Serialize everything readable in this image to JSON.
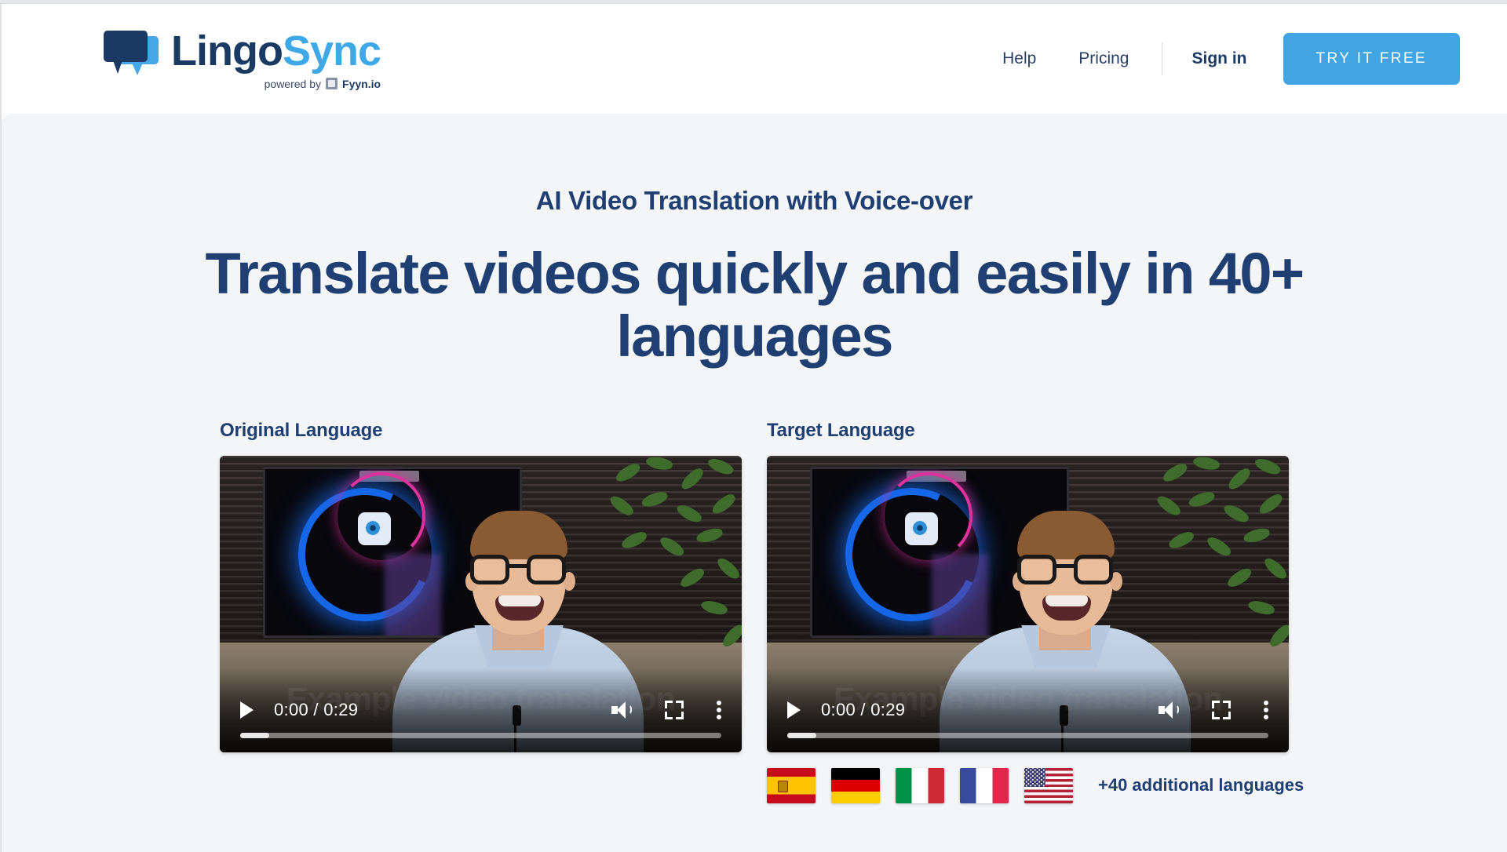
{
  "brand": {
    "name_part1": "Lingo",
    "name_part2": "Sync",
    "powered_label": "powered by",
    "powered_name": "Fyyn.io",
    "logo_icon": "speech-bubbles-icon",
    "fyyn_icon": "fyyn-square-icon",
    "colors": {
      "navy": "#1b3a63",
      "light_blue": "#3fa9e8"
    }
  },
  "header": {
    "nav": [
      {
        "label": "Help"
      },
      {
        "label": "Pricing"
      }
    ],
    "signin_label": "Sign in",
    "cta_label": "TRY IT FREE",
    "cta_color": "#41a5e4"
  },
  "hero": {
    "eyebrow": "AI Video Translation with Voice-over",
    "headline": "Translate videos quickly and easily in 40+ languages",
    "heading_color": "#1f3f73",
    "background_color": "#f4f5f6"
  },
  "videos": [
    {
      "label": "Original Language",
      "player": {
        "play_icon": "play-icon",
        "time": "0:00 / 0:29",
        "current_time": "0:00",
        "duration": "0:29",
        "volume_icon": "volume-icon",
        "fullscreen_icon": "fullscreen-icon",
        "more_icon": "kebab-menu-icon",
        "progress_percent": 6,
        "watermark": "Example video translation"
      }
    },
    {
      "label": "Target Language",
      "player": {
        "play_icon": "play-icon",
        "time": "0:00 / 0:29",
        "current_time": "0:00",
        "duration": "0:29",
        "volume_icon": "volume-icon",
        "fullscreen_icon": "fullscreen-icon",
        "more_icon": "kebab-menu-icon",
        "progress_percent": 6,
        "watermark": "Example video translation"
      }
    }
  ],
  "languages": {
    "flags": [
      {
        "name": "Spain",
        "code": "es"
      },
      {
        "name": "Germany",
        "code": "de"
      },
      {
        "name": "Italy",
        "code": "it"
      },
      {
        "name": "France",
        "code": "fr"
      },
      {
        "name": "United States",
        "code": "us"
      }
    ],
    "note": "+40 additional languages"
  }
}
